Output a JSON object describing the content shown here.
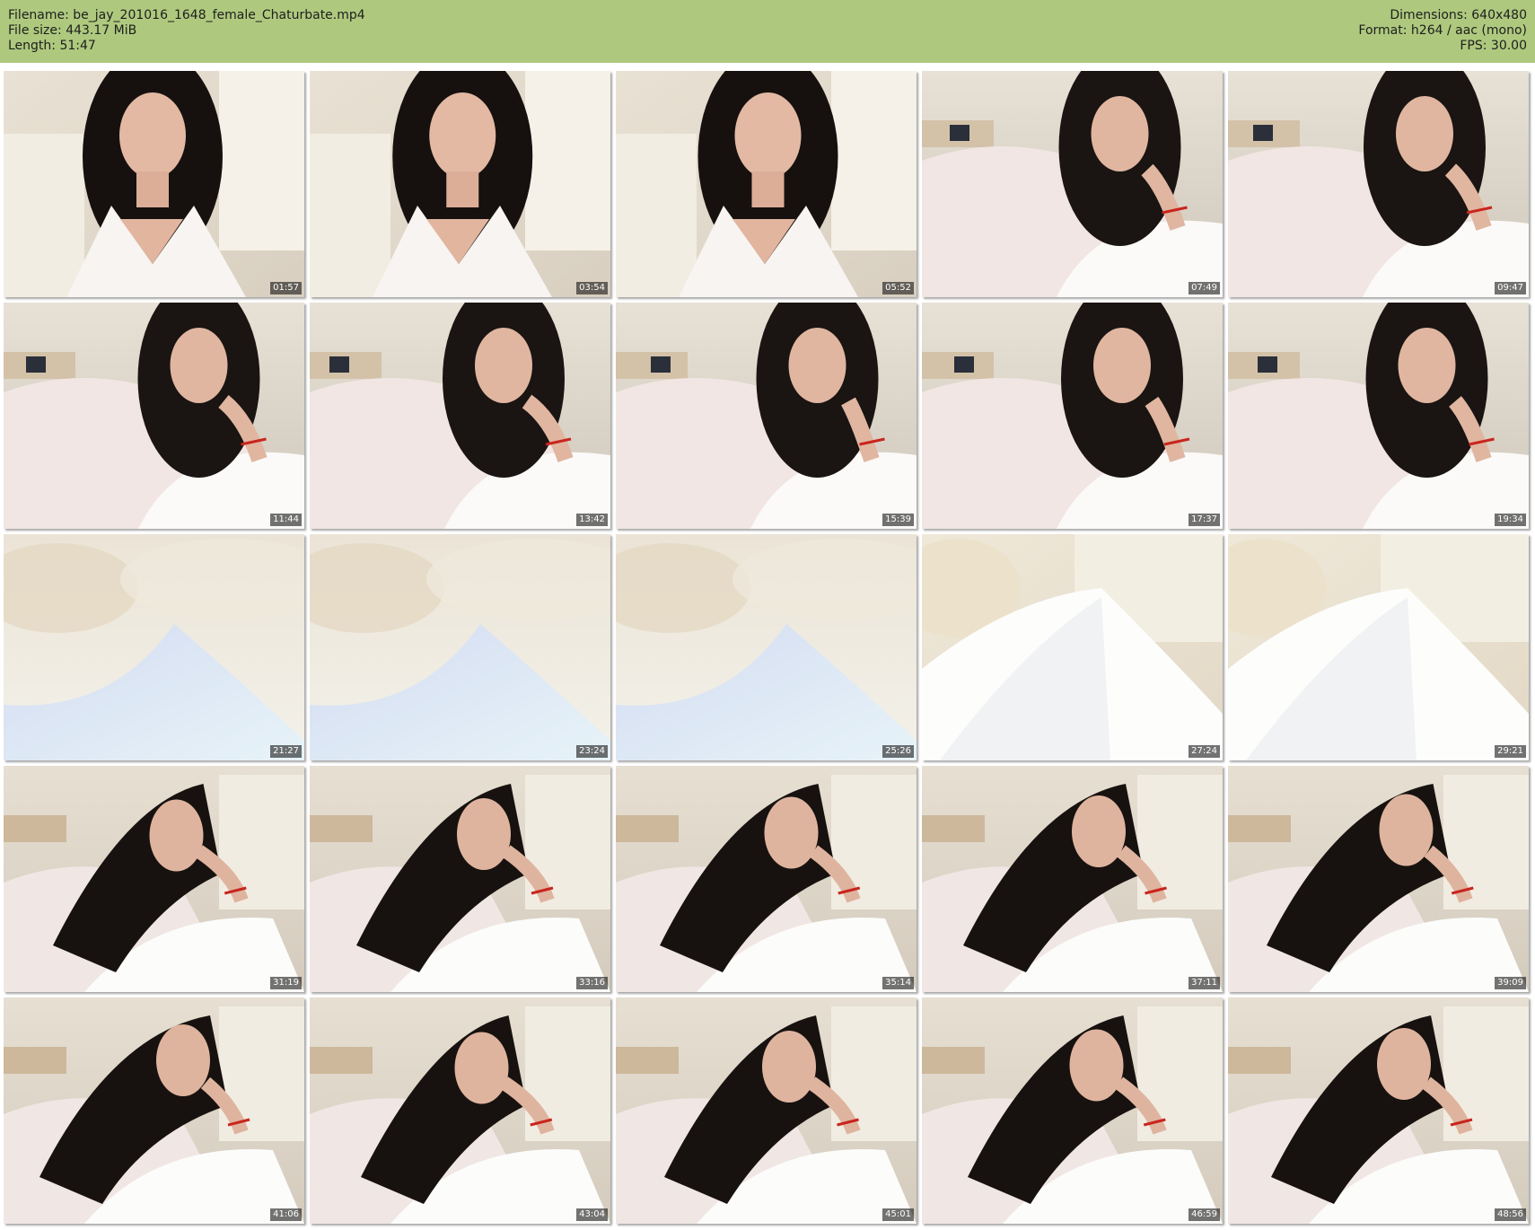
{
  "info": {
    "filename": "Filename: be_jay_201016_1648_female_Chaturbate.mp4",
    "filesize": "File size: 443.17 MiB",
    "length": "Length: 51:47",
    "dimensions": "Dimensions: 640x480",
    "format": "Format: h264 / aac (mono)",
    "fps": "FPS: 30.00"
  },
  "colors": {
    "header_bg": "#aec97e",
    "timestamp_bg": "rgba(0,0,0,0.55)"
  },
  "thumbnails": [
    {
      "timestamp": "01:57",
      "scene": "portrait"
    },
    {
      "timestamp": "03:54",
      "scene": "portrait"
    },
    {
      "timestamp": "05:52",
      "scene": "portrait"
    },
    {
      "timestamp": "07:49",
      "scene": "reclining"
    },
    {
      "timestamp": "09:47",
      "scene": "reclining"
    },
    {
      "timestamp": "11:44",
      "scene": "reclining"
    },
    {
      "timestamp": "13:42",
      "scene": "reclining"
    },
    {
      "timestamp": "15:39",
      "scene": "reclining"
    },
    {
      "timestamp": "17:37",
      "scene": "reclining"
    },
    {
      "timestamp": "19:34",
      "scene": "reclining"
    },
    {
      "timestamp": "21:27",
      "scene": "blur"
    },
    {
      "timestamp": "23:24",
      "scene": "blur"
    },
    {
      "timestamp": "25:26",
      "scene": "blur"
    },
    {
      "timestamp": "27:24",
      "scene": "bedding"
    },
    {
      "timestamp": "29:21",
      "scene": "bedding"
    },
    {
      "timestamp": "31:19",
      "scene": "lying"
    },
    {
      "timestamp": "33:16",
      "scene": "lying"
    },
    {
      "timestamp": "35:14",
      "scene": "lying"
    },
    {
      "timestamp": "37:11",
      "scene": "lying"
    },
    {
      "timestamp": "39:09",
      "scene": "lying"
    },
    {
      "timestamp": "41:06",
      "scene": "lying"
    },
    {
      "timestamp": "43:04",
      "scene": "lying"
    },
    {
      "timestamp": "45:01",
      "scene": "lying"
    },
    {
      "timestamp": "46:59",
      "scene": "lying"
    },
    {
      "timestamp": "48:56",
      "scene": "lying"
    }
  ]
}
